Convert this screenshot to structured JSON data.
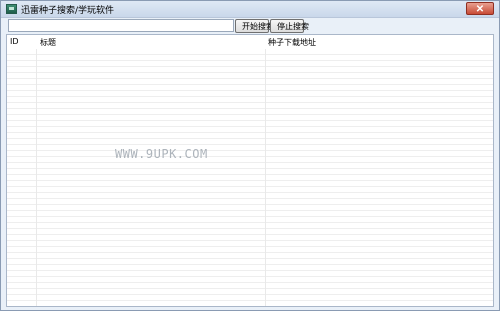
{
  "window": {
    "title": "迅雷种子搜索/学玩软件",
    "close_label": "✕"
  },
  "toolbar": {
    "search_value": "",
    "start_label": "开始搜索",
    "stop_label": "停止搜索"
  },
  "table": {
    "columns": [
      "ID",
      "标题",
      "种子下载地址"
    ],
    "rows": []
  },
  "watermark": "WWW.9UPK.COM"
}
